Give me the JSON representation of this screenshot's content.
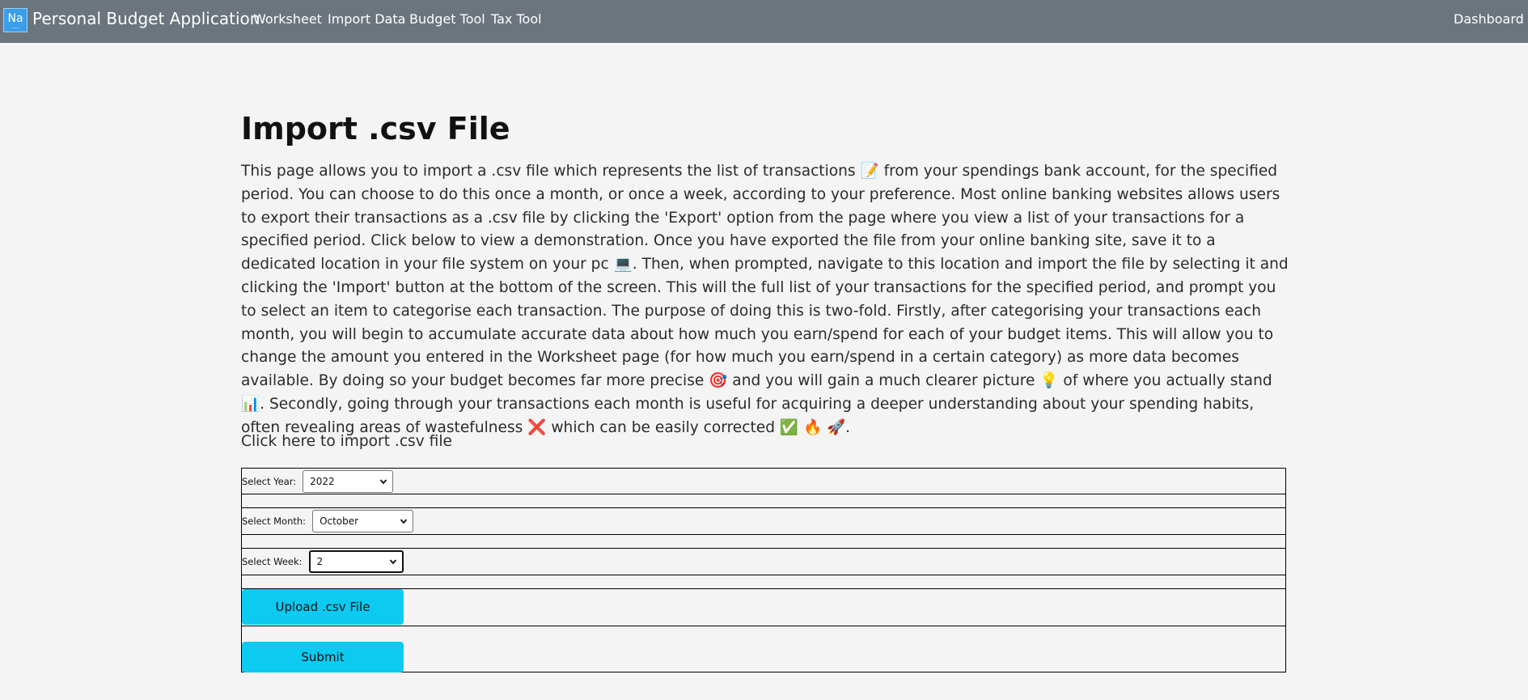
{
  "navbar": {
    "logo_text": "Na",
    "brand_title": "Personal Budget Application",
    "links": [
      "Worksheet",
      "Import Data",
      "Budget Tool",
      "Tax Tool"
    ],
    "right_link": "Dashboard"
  },
  "main": {
    "title": "Import .csv File",
    "intro": "This page allows you to import a .csv file which represents the list of transactions 📝 from your spendings bank account, for the specified period. You can choose to do this once a month, or once a week, according to your preference. Most online banking websites allows users to export their transactions as a .csv file by clicking the 'Export' option from the page where you view a list of your transactions for a specified period. Click below to view a demonstration. Once you have exported the file from your online banking site, save it to a dedicated location in your file system on your pc 💻. Then, when prompted, navigate to this location and import the file by selecting it and clicking the 'Import' button at the bottom of the screen. This will the full list of your transactions for the specified period, and prompt you to select an item to categorise each transaction. The purpose of doing this is two-fold. Firstly, after categorising your transactions each month, you will begin to accumulate accurate data about how much you earn/spend for each of your budget items. This will allow you to change the amount you entered in the Worksheet page (for how much you earn/spend in a certain category) as more data becomes available. By doing so your budget becomes far more precise 🎯 and you will gain a much clearer picture 💡 of where you actually stand 📊. Secondly, going through your transactions each month is useful for acquiring a deeper understanding about your spending habits, often revealing areas of wastefulness ❌ which can be easily corrected ✅ 🔥 🚀.",
    "click_here": "Click here to import .csv file"
  },
  "form": {
    "year_label": "Select Year:",
    "year_value": "2022",
    "month_label": "Select Month:",
    "month_value": "October",
    "week_label": "Select Week:",
    "week_value": "2",
    "upload_label": "Upload .csv File",
    "submit_label": "Submit"
  },
  "colors": {
    "navbar_bg": "#6c757d",
    "page_bg": "#f4f4f4",
    "button_bg": "#0dcaf0",
    "logo_bg": "#3b9ee8"
  }
}
